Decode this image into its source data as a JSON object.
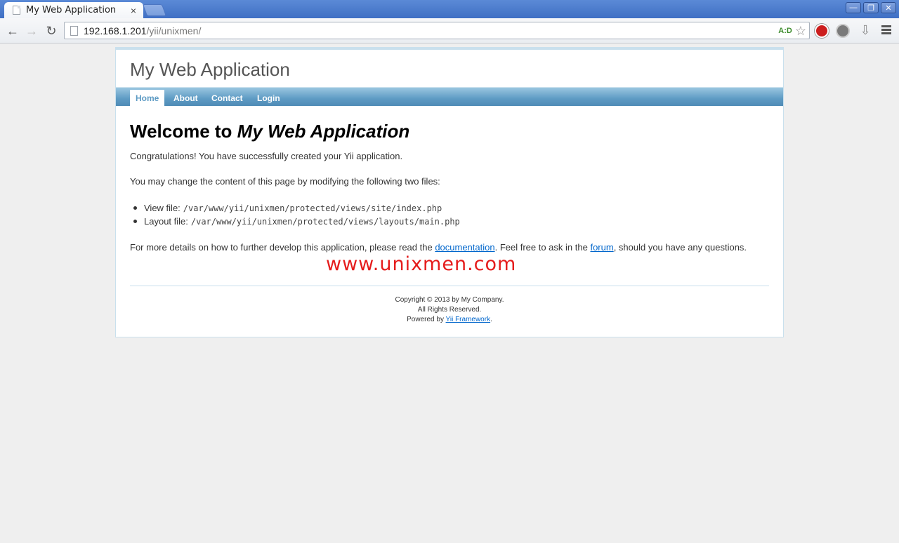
{
  "browser": {
    "tab_title": "My Web Application",
    "tab_close": "×",
    "url_host": "192.168.1.201",
    "url_path": "/yii/unixmen/",
    "adblock_label": "A:D",
    "window_buttons": [
      "—",
      "❐",
      "✕"
    ]
  },
  "site": {
    "title": "My Web Application",
    "menu": [
      "Home",
      "About",
      "Contact",
      "Login"
    ],
    "active_menu": "Home"
  },
  "content": {
    "welcome_prefix": "Welcome to ",
    "welcome_name": "My Web Application",
    "congrats": "Congratulations! You have successfully created your Yii application.",
    "change_text": "You may change the content of this page by modifying the following two files:",
    "files": [
      {
        "label": "View file:",
        "path": "/var/www/yii/unixmen/protected/views/site/index.php"
      },
      {
        "label": "Layout file:",
        "path": "/var/www/yii/unixmen/protected/views/layouts/main.php"
      }
    ],
    "details_prefix": "For more details on how to further develop this application, please read the ",
    "docs_link": "documentation",
    "details_middle": ". Feel free to ask in the ",
    "forum_link": "forum",
    "details_suffix": ", should you have any questions.",
    "watermark": "www.unixmen.com"
  },
  "footer": {
    "copyright": "Copyright © 2013 by My Company.",
    "rights": "All Rights Reserved.",
    "powered_prefix": "Powered by ",
    "framework_link": "Yii Framework",
    "powered_suffix": "."
  },
  "colors": {
    "menu_blue": "#5e9bc4",
    "link": "#0066cc",
    "watermark": "#e51c1c"
  }
}
